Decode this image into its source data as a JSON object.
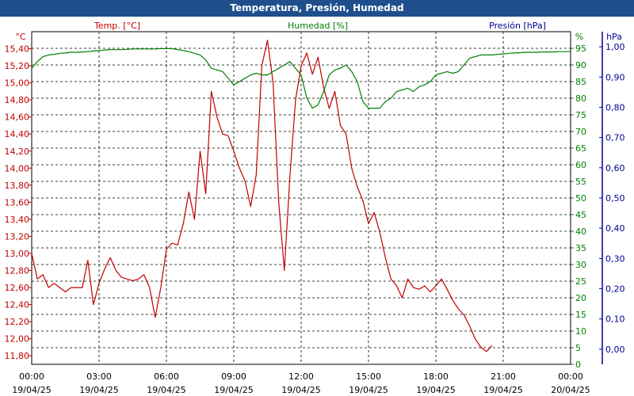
{
  "window_title": "Temperatura, Presión, Humedad",
  "chart_data": {
    "type": "line",
    "title": "Temperatura, Presión, Humedad",
    "x_ticks": [
      {
        "time": "00:00",
        "date": "19/04/25",
        "h": 0
      },
      {
        "time": "03:00",
        "date": "19/04/25",
        "h": 3
      },
      {
        "time": "06:00",
        "date": "19/04/25",
        "h": 6
      },
      {
        "time": "09:00",
        "date": "19/04/25",
        "h": 9
      },
      {
        "time": "12:00",
        "date": "19/04/25",
        "h": 12
      },
      {
        "time": "15:00",
        "date": "19/04/25",
        "h": 15
      },
      {
        "time": "18:00",
        "date": "19/04/25",
        "h": 18
      },
      {
        "time": "21:00",
        "date": "19/04/25",
        "h": 21
      },
      {
        "time": "00:00",
        "date": "20/04/25",
        "h": 24
      }
    ],
    "x_range_hours": [
      0,
      24
    ],
    "grid": true,
    "axes": {
      "temperature": {
        "label": "Temp. [°C]",
        "unit": "°C",
        "color": "#c00000",
        "min": 11.7,
        "max": 15.6,
        "ticks": [
          "11,80",
          "12,00",
          "12,20",
          "12,40",
          "12,60",
          "12,80",
          "13,00",
          "13,20",
          "13,40",
          "13,60",
          "13,80",
          "14,00",
          "14,20",
          "14,40",
          "14,60",
          "14,80",
          "15,00",
          "15,20",
          "15,40"
        ]
      },
      "humidity": {
        "label": "Humedad [%]",
        "unit": "%",
        "color": "#008000",
        "min": 0,
        "max": 100,
        "ticks": [
          "0",
          "5",
          "10",
          "15",
          "20",
          "25",
          "30",
          "35",
          "40",
          "45",
          "50",
          "55",
          "60",
          "65",
          "70",
          "75",
          "80",
          "85",
          "90",
          "95"
        ]
      },
      "pressure": {
        "label": "Presión [hPa]",
        "unit": "hPa",
        "color": "#000090",
        "min": -0.05,
        "max": 1.05,
        "ticks": [
          "0,00",
          "0,10",
          "0,20",
          "0,30",
          "0,40",
          "0,50",
          "0,60",
          "0,70",
          "0,80",
          "0,90",
          "1,00"
        ]
      }
    },
    "series": [
      {
        "name": "Temp. [°C]",
        "axis": "temperature",
        "color": "#c00000",
        "x_hours": [
          0,
          0.25,
          0.5,
          0.75,
          1,
          1.25,
          1.5,
          1.75,
          2,
          2.25,
          2.5,
          2.75,
          3,
          3.25,
          3.5,
          3.75,
          4,
          4.25,
          4.5,
          4.75,
          5,
          5.25,
          5.5,
          5.75,
          6,
          6.25,
          6.5,
          6.75,
          7,
          7.25,
          7.5,
          7.75,
          8,
          8.25,
          8.5,
          8.75,
          9,
          9.25,
          9.5,
          9.75,
          10,
          10.25,
          10.5,
          10.75,
          11,
          11.25,
          11.5,
          11.75,
          12,
          12.25,
          12.5,
          12.75,
          13,
          13.25,
          13.5,
          13.75,
          14,
          14.25,
          14.5,
          14.75,
          15,
          15.25,
          15.5,
          15.75,
          16,
          16.25,
          16.5,
          16.75,
          17,
          17.25,
          17.5,
          17.75,
          18,
          18.25,
          18.5,
          18.75,
          19,
          19.25,
          19.5,
          19.75,
          20,
          20.25,
          20.5,
          20.75,
          21,
          21.25,
          21.5,
          21.75,
          22,
          22.25,
          22.5,
          22.75,
          23,
          23.25,
          23.5,
          23.75,
          24
        ],
        "values": [
          13.0,
          12.7,
          12.75,
          12.6,
          12.65,
          12.6,
          12.55,
          12.6,
          12.6,
          12.6,
          12.92,
          12.4,
          12.65,
          12.82,
          12.95,
          12.8,
          12.72,
          12.7,
          12.68,
          12.7,
          12.75,
          12.6,
          12.25,
          12.6,
          13.05,
          13.12,
          13.1,
          13.35,
          13.72,
          13.4,
          14.2,
          13.7,
          14.9,
          14.6,
          14.4,
          14.38,
          14.2,
          14.0,
          13.85,
          13.55,
          13.92,
          15.2,
          15.5,
          15.0,
          13.6,
          12.8,
          13.9,
          14.8,
          15.2,
          15.35,
          15.1,
          15.3,
          14.95,
          14.7,
          14.9,
          14.5,
          14.4,
          14.0,
          13.78,
          13.62,
          13.35,
          13.48,
          13.25,
          12.95,
          12.7,
          12.62,
          12.48,
          12.7,
          12.6,
          12.58,
          12.62,
          12.55,
          12.62,
          12.7,
          12.58,
          12.45,
          12.35,
          12.28,
          12.15,
          12.0,
          11.9,
          11.85,
          11.92
        ]
      },
      {
        "name": "Humedad [%]",
        "axis": "humidity",
        "color": "#008000",
        "x_hours": [
          0,
          0.25,
          0.5,
          0.75,
          1,
          1.25,
          1.5,
          1.75,
          2,
          2.25,
          2.5,
          2.75,
          3,
          3.25,
          3.5,
          3.75,
          4,
          4.25,
          4.5,
          4.75,
          5,
          5.25,
          5.5,
          5.75,
          6,
          6.25,
          6.5,
          6.75,
          7,
          7.25,
          7.5,
          7.75,
          8,
          8.25,
          8.5,
          8.75,
          9,
          9.25,
          9.5,
          9.75,
          10,
          10.25,
          10.5,
          10.75,
          11,
          11.25,
          11.5,
          11.75,
          12,
          12.25,
          12.5,
          12.75,
          13,
          13.25,
          13.5,
          13.75,
          14,
          14.25,
          14.5,
          14.75,
          15,
          15.25,
          15.5,
          15.75,
          16,
          16.25,
          16.5,
          16.75,
          17,
          17.25,
          17.5,
          17.75,
          18,
          18.25,
          18.5,
          18.75,
          19,
          19.25,
          19.5,
          19.75,
          20,
          20.25,
          20.5,
          20.75,
          21,
          21.25,
          21.5,
          21.75,
          22,
          22.25,
          22.5,
          22.75,
          23,
          23.25,
          23.5,
          23.75,
          24
        ],
        "values": [
          89,
          91,
          92.5,
          93,
          93.2,
          93.5,
          93.6,
          93.8,
          93.8,
          93.9,
          94,
          94.2,
          94.3,
          94.5,
          94.6,
          94.6,
          94.6,
          94.7,
          94.8,
          94.8,
          94.8,
          94.8,
          94.8,
          94.9,
          94.9,
          94.9,
          94.6,
          94.3,
          94,
          93.5,
          93,
          91.5,
          89,
          88.5,
          88,
          86,
          84,
          85,
          86,
          87,
          87.5,
          87,
          87,
          88,
          89,
          90,
          91,
          89,
          87,
          80,
          77,
          78,
          82,
          87,
          88.5,
          89,
          90,
          88,
          85,
          79,
          77,
          77,
          77,
          79,
          80,
          82,
          82.5,
          83,
          82,
          83.5,
          84,
          85,
          87,
          87.5,
          88,
          87.5,
          88,
          90,
          92,
          92.5,
          93,
          93,
          93,
          93.2,
          93.3,
          93.5,
          93.6,
          93.7,
          93.8,
          93.8,
          93.8,
          93.9,
          93.9,
          93.9,
          94,
          94,
          94
        ]
      }
    ]
  }
}
